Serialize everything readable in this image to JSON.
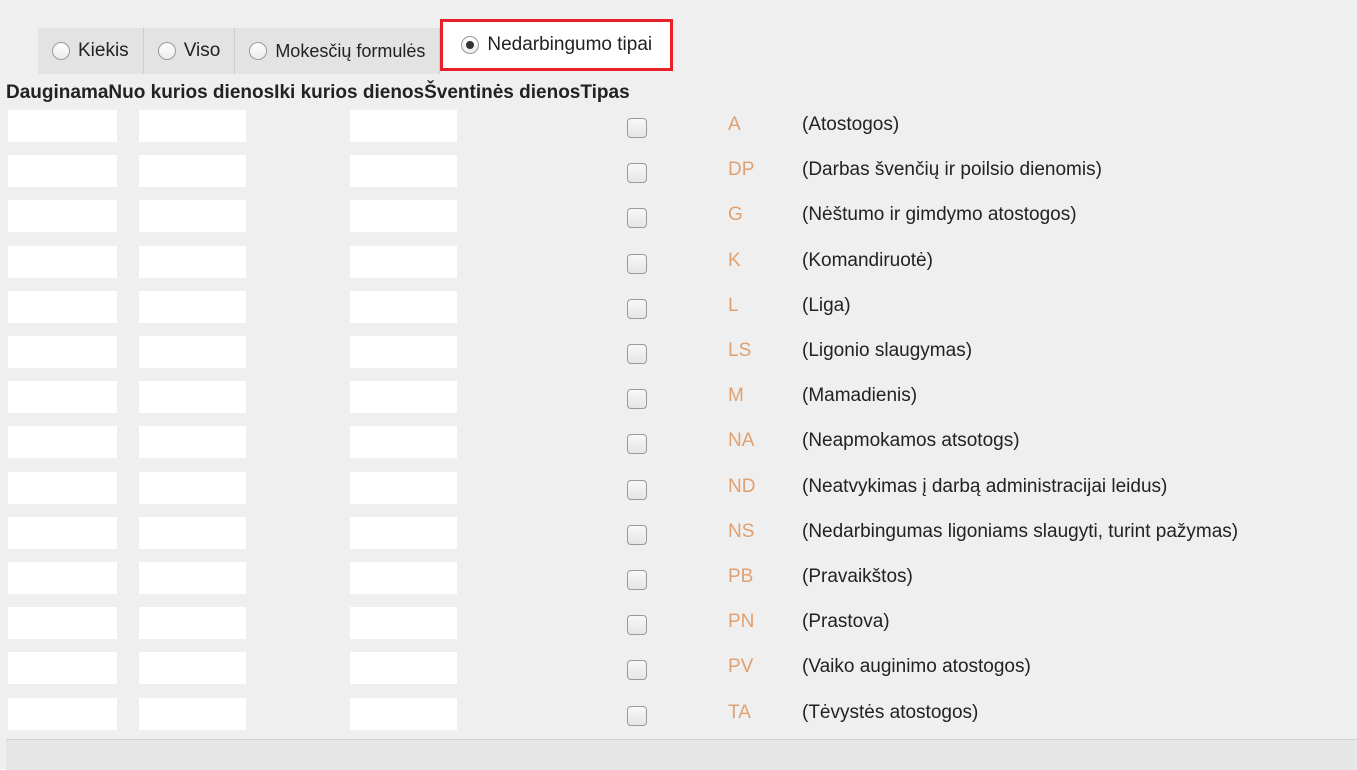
{
  "tabs": [
    {
      "label": "Kiekis",
      "checked": false
    },
    {
      "label": "Viso",
      "checked": false
    },
    {
      "label": "Mokesčių formulės",
      "checked": false
    },
    {
      "label": "Nedarbingumo tipai",
      "checked": true
    }
  ],
  "highlight_color": "#e8202a",
  "code_color": "#e0a070",
  "table": {
    "headers": [
      "Dauginama",
      "Nuo kurios dienos",
      "Iki kurios dienos",
      "Šventinės dienos",
      "Tipas"
    ],
    "rows": [
      {
        "code": "A",
        "desc": "(Atostogos)"
      },
      {
        "code": "DP",
        "desc": "(Darbas švenčių ir poilsio dienomis)"
      },
      {
        "code": "G",
        "desc": "(Nėštumo ir gimdymo atostogos)"
      },
      {
        "code": "K",
        "desc": "(Komandiruotė)"
      },
      {
        "code": "L",
        "desc": "(Liga)"
      },
      {
        "code": "LS",
        "desc": "(Ligonio slaugymas)"
      },
      {
        "code": "M",
        "desc": "(Mamadienis)"
      },
      {
        "code": "NA",
        "desc": "(Neapmokamos atsotogs)"
      },
      {
        "code": "ND",
        "desc": "(Neatvykimas į darbą administracijai leidus)"
      },
      {
        "code": "NS",
        "desc": "(Nedarbingumas ligoniams slaugyti, turint pažymas)"
      },
      {
        "code": "PB",
        "desc": "(Pravaikštos)"
      },
      {
        "code": "PN",
        "desc": "(Prastova)"
      },
      {
        "code": "PV",
        "desc": "(Vaiko auginimo atostogos)"
      },
      {
        "code": "TA",
        "desc": "(Tėvystės atostogos)"
      }
    ]
  }
}
